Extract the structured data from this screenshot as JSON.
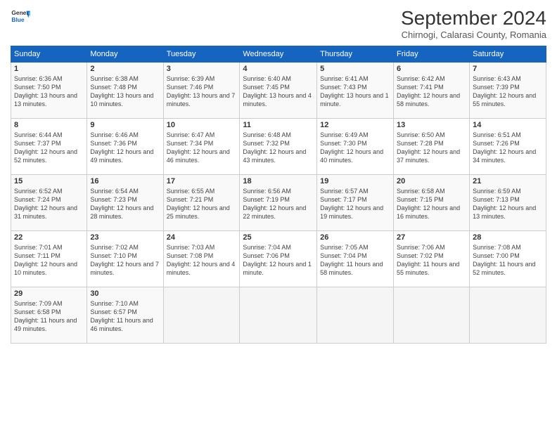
{
  "logo": {
    "line1": "General",
    "line2": "Blue"
  },
  "title": "September 2024",
  "subtitle": "Chirnogi, Calarasi County, Romania",
  "weekdays": [
    "Sunday",
    "Monday",
    "Tuesday",
    "Wednesday",
    "Thursday",
    "Friday",
    "Saturday"
  ],
  "weeks": [
    [
      {
        "day": "1",
        "info": "Sunrise: 6:36 AM\nSunset: 7:50 PM\nDaylight: 13 hours\nand 13 minutes."
      },
      {
        "day": "2",
        "info": "Sunrise: 6:38 AM\nSunset: 7:48 PM\nDaylight: 13 hours\nand 10 minutes."
      },
      {
        "day": "3",
        "info": "Sunrise: 6:39 AM\nSunset: 7:46 PM\nDaylight: 13 hours\nand 7 minutes."
      },
      {
        "day": "4",
        "info": "Sunrise: 6:40 AM\nSunset: 7:45 PM\nDaylight: 13 hours\nand 4 minutes."
      },
      {
        "day": "5",
        "info": "Sunrise: 6:41 AM\nSunset: 7:43 PM\nDaylight: 13 hours\nand 1 minute."
      },
      {
        "day": "6",
        "info": "Sunrise: 6:42 AM\nSunset: 7:41 PM\nDaylight: 12 hours\nand 58 minutes."
      },
      {
        "day": "7",
        "info": "Sunrise: 6:43 AM\nSunset: 7:39 PM\nDaylight: 12 hours\nand 55 minutes."
      }
    ],
    [
      {
        "day": "8",
        "info": "Sunrise: 6:44 AM\nSunset: 7:37 PM\nDaylight: 12 hours\nand 52 minutes."
      },
      {
        "day": "9",
        "info": "Sunrise: 6:46 AM\nSunset: 7:36 PM\nDaylight: 12 hours\nand 49 minutes."
      },
      {
        "day": "10",
        "info": "Sunrise: 6:47 AM\nSunset: 7:34 PM\nDaylight: 12 hours\nand 46 minutes."
      },
      {
        "day": "11",
        "info": "Sunrise: 6:48 AM\nSunset: 7:32 PM\nDaylight: 12 hours\nand 43 minutes."
      },
      {
        "day": "12",
        "info": "Sunrise: 6:49 AM\nSunset: 7:30 PM\nDaylight: 12 hours\nand 40 minutes."
      },
      {
        "day": "13",
        "info": "Sunrise: 6:50 AM\nSunset: 7:28 PM\nDaylight: 12 hours\nand 37 minutes."
      },
      {
        "day": "14",
        "info": "Sunrise: 6:51 AM\nSunset: 7:26 PM\nDaylight: 12 hours\nand 34 minutes."
      }
    ],
    [
      {
        "day": "15",
        "info": "Sunrise: 6:52 AM\nSunset: 7:24 PM\nDaylight: 12 hours\nand 31 minutes."
      },
      {
        "day": "16",
        "info": "Sunrise: 6:54 AM\nSunset: 7:23 PM\nDaylight: 12 hours\nand 28 minutes."
      },
      {
        "day": "17",
        "info": "Sunrise: 6:55 AM\nSunset: 7:21 PM\nDaylight: 12 hours\nand 25 minutes."
      },
      {
        "day": "18",
        "info": "Sunrise: 6:56 AM\nSunset: 7:19 PM\nDaylight: 12 hours\nand 22 minutes."
      },
      {
        "day": "19",
        "info": "Sunrise: 6:57 AM\nSunset: 7:17 PM\nDaylight: 12 hours\nand 19 minutes."
      },
      {
        "day": "20",
        "info": "Sunrise: 6:58 AM\nSunset: 7:15 PM\nDaylight: 12 hours\nand 16 minutes."
      },
      {
        "day": "21",
        "info": "Sunrise: 6:59 AM\nSunset: 7:13 PM\nDaylight: 12 hours\nand 13 minutes."
      }
    ],
    [
      {
        "day": "22",
        "info": "Sunrise: 7:01 AM\nSunset: 7:11 PM\nDaylight: 12 hours\nand 10 minutes."
      },
      {
        "day": "23",
        "info": "Sunrise: 7:02 AM\nSunset: 7:10 PM\nDaylight: 12 hours\nand 7 minutes."
      },
      {
        "day": "24",
        "info": "Sunrise: 7:03 AM\nSunset: 7:08 PM\nDaylight: 12 hours\nand 4 minutes."
      },
      {
        "day": "25",
        "info": "Sunrise: 7:04 AM\nSunset: 7:06 PM\nDaylight: 12 hours\nand 1 minute."
      },
      {
        "day": "26",
        "info": "Sunrise: 7:05 AM\nSunset: 7:04 PM\nDaylight: 11 hours\nand 58 minutes."
      },
      {
        "day": "27",
        "info": "Sunrise: 7:06 AM\nSunset: 7:02 PM\nDaylight: 11 hours\nand 55 minutes."
      },
      {
        "day": "28",
        "info": "Sunrise: 7:08 AM\nSunset: 7:00 PM\nDaylight: 11 hours\nand 52 minutes."
      }
    ],
    [
      {
        "day": "29",
        "info": "Sunrise: 7:09 AM\nSunset: 6:58 PM\nDaylight: 11 hours\nand 49 minutes."
      },
      {
        "day": "30",
        "info": "Sunrise: 7:10 AM\nSunset: 6:57 PM\nDaylight: 11 hours\nand 46 minutes."
      },
      null,
      null,
      null,
      null,
      null
    ]
  ]
}
